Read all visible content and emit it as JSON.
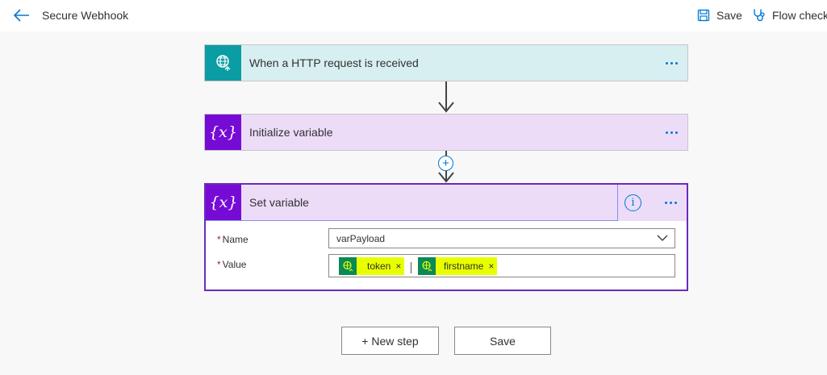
{
  "header": {
    "title": "Secure Webhook",
    "save_label": "Save",
    "flow_checker_label": "Flow checker"
  },
  "steps": [
    {
      "title": "When a HTTP request is received",
      "icon": "http-request-globe-icon",
      "color": "#0a9da3"
    },
    {
      "title": "Initialize variable",
      "icon": "variable-icon",
      "color": "#770bd6"
    }
  ],
  "set_variable": {
    "title": "Set variable",
    "fields": {
      "name_label": "Name",
      "name_value": "varPayload",
      "value_label": "Value",
      "required_marker": "*"
    },
    "tokens": [
      {
        "label": "token",
        "close": "×",
        "highlighted": true
      },
      {
        "label": "firstname",
        "close": "×",
        "highlighted": true
      }
    ]
  },
  "glyphs": {
    "variable": "{𝑥}",
    "plus": "+",
    "info": "i"
  },
  "footer": {
    "new_step_label": "+ New step",
    "save_label": "Save"
  },
  "colors": {
    "accent": "#0078d4",
    "variable_purple": "#770bd6",
    "http_teal": "#0a9da3",
    "token_green": "#0a8a55",
    "highlight": "#e8ff00"
  }
}
